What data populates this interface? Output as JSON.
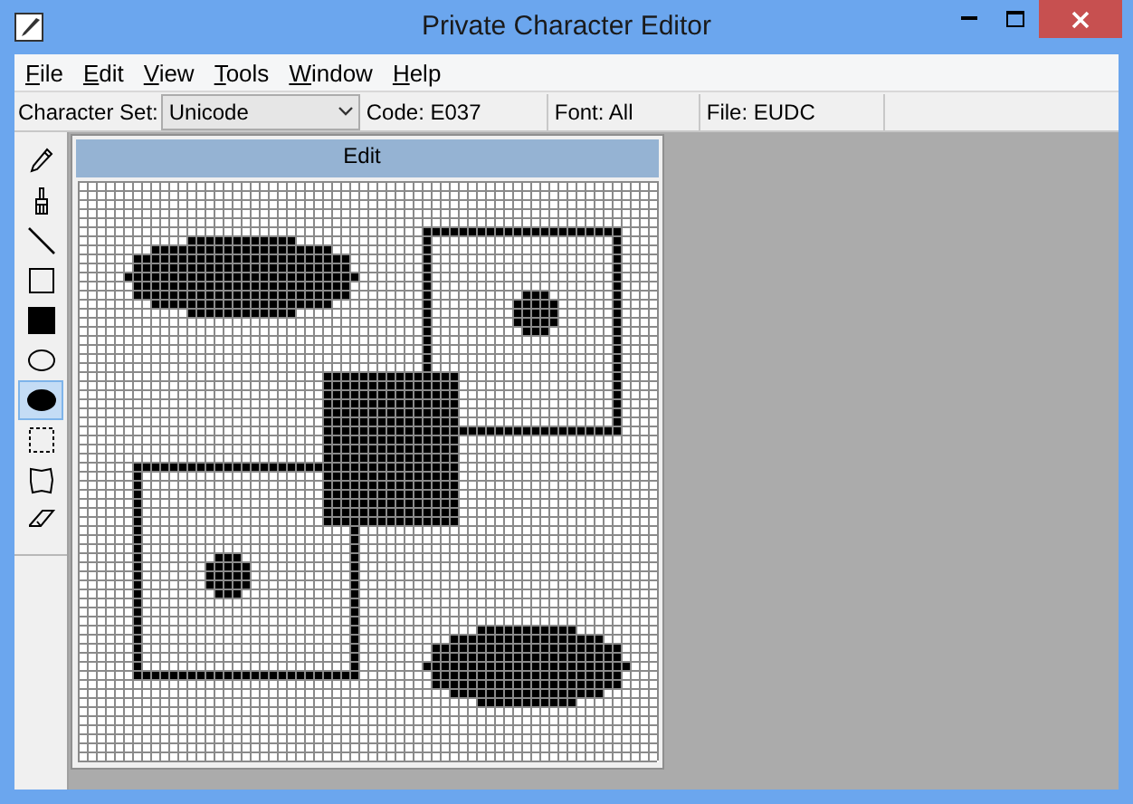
{
  "window": {
    "title": "Private Character Editor"
  },
  "menu": [
    "File",
    "Edit",
    "View",
    "Tools",
    "Window",
    "Help"
  ],
  "toolbar": {
    "character_set_label": "Character Set:",
    "character_set_value": "Unicode",
    "code": "Code: E037",
    "font": "Font: All",
    "file": "File: EUDC"
  },
  "tools": [
    {
      "kind": "pencil",
      "selected": false
    },
    {
      "kind": "brush",
      "selected": false
    },
    {
      "kind": "line",
      "selected": false
    },
    {
      "kind": "hollow-rectangle",
      "selected": false
    },
    {
      "kind": "filled-rectangle",
      "selected": false
    },
    {
      "kind": "hollow-ellipse",
      "selected": false
    },
    {
      "kind": "filled-ellipse",
      "selected": true
    },
    {
      "kind": "rectangle-selection",
      "selected": false
    },
    {
      "kind": "freeform-selection",
      "selected": false
    },
    {
      "kind": "eraser",
      "selected": false
    }
  ],
  "edit_window": {
    "title": "Edit"
  }
}
